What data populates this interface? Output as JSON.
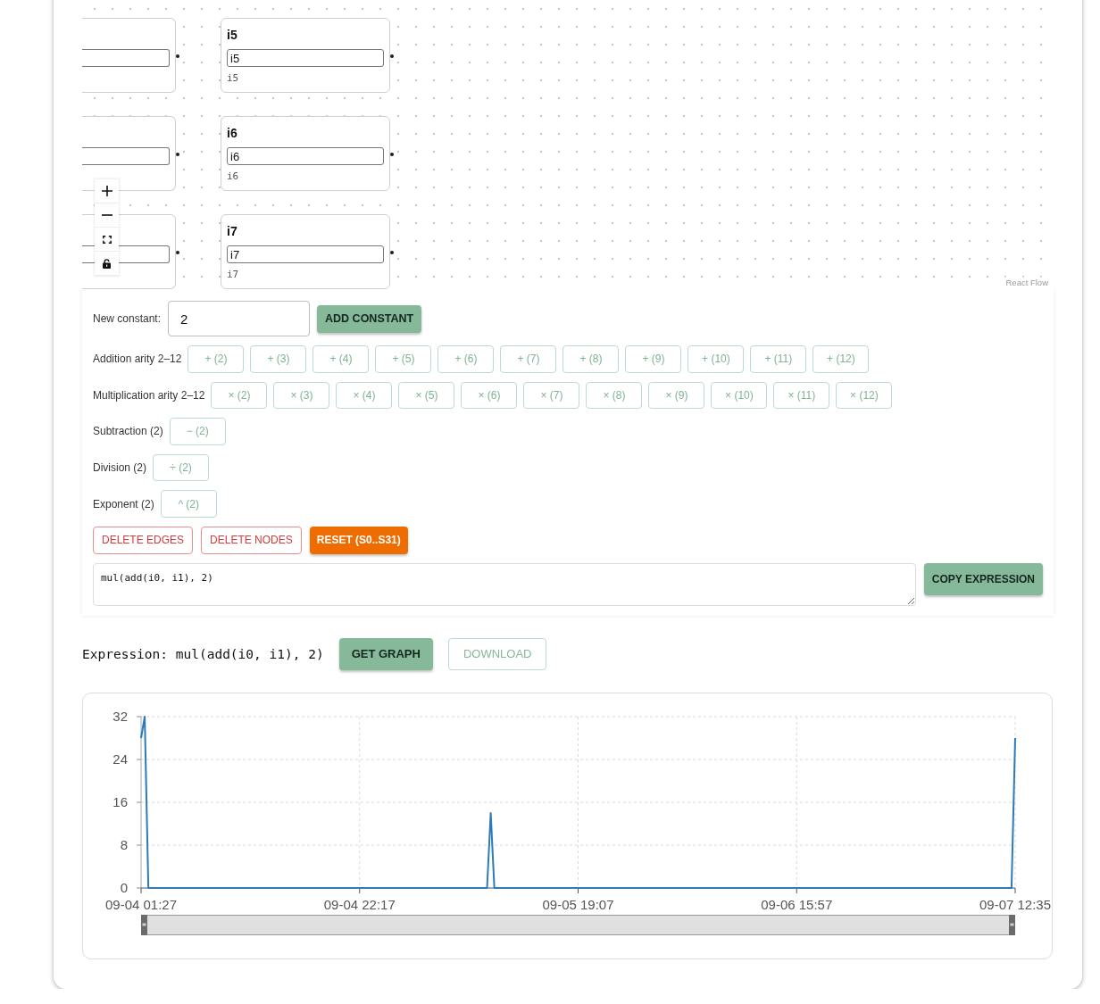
{
  "flow": {
    "nodes": [
      {
        "kind": "clipped"
      },
      {
        "kind": "input",
        "title": "i5",
        "value": "i5",
        "caption": "i5"
      },
      {
        "kind": "clipped"
      },
      {
        "kind": "input",
        "title": "i6",
        "value": "i6",
        "caption": "i6"
      },
      {
        "kind": "clipped"
      },
      {
        "kind": "input",
        "title": "i7",
        "value": "i7",
        "caption": "i7"
      }
    ],
    "locked": false,
    "attribution": "React Flow"
  },
  "controls": {
    "constant": {
      "label": "New constant:",
      "value": "2",
      "button": "ADD CONSTANT"
    },
    "operator_rows": [
      {
        "label": "Addition arity 2–12",
        "buttons": [
          "+ (2)",
          "+ (3)",
          "+ (4)",
          "+ (5)",
          "+ (6)",
          "+ (7)",
          "+ (8)",
          "+ (9)",
          "+ (10)",
          "+ (11)",
          "+ (12)"
        ]
      },
      {
        "label": "Multiplication arity 2–12",
        "buttons": [
          "× (2)",
          "× (3)",
          "× (4)",
          "× (5)",
          "× (6)",
          "× (7)",
          "× (8)",
          "× (9)",
          "× (10)",
          "× (11)",
          "× (12)"
        ]
      },
      {
        "label": "Subtraction (2)",
        "buttons": [
          "− (2)"
        ]
      },
      {
        "label": "Division (2)",
        "buttons": [
          "÷ (2)"
        ]
      },
      {
        "label": "Exponent (2)",
        "buttons": [
          "^ (2)"
        ]
      }
    ],
    "actions": [
      {
        "label": "DELETE EDGES",
        "kind": "danger"
      },
      {
        "label": "DELETE NODES",
        "kind": "danger"
      },
      {
        "label": "RESET (S0..S31)",
        "kind": "warning"
      }
    ],
    "expression_box": {
      "value": "mul(add(i0, i1), 2)",
      "button": "COPY EXPRESSION"
    }
  },
  "expression_bar": {
    "text": "Expression: mul(add(i0, i1), 2)",
    "buttons": [
      {
        "label": "GET GRAPH",
        "kind": "primary"
      },
      {
        "label": "DOWNLOAD",
        "kind": "secondary"
      }
    ]
  },
  "chart": {
    "chart_data": {
      "type": "line",
      "grid": true,
      "categories": [
        "09-04 01:27",
        null,
        null,
        null,
        null,
        null,
        null,
        null,
        null,
        null,
        null,
        null,
        null,
        null,
        null,
        null,
        null,
        null,
        null,
        null,
        null,
        null,
        null,
        null,
        null,
        null,
        null,
        null,
        null,
        null,
        null,
        null,
        null,
        null,
        null,
        null,
        null,
        null,
        null,
        null,
        null,
        null,
        null,
        null,
        null,
        null,
        null,
        null,
        null,
        null,
        null,
        null,
        null,
        null,
        null,
        null,
        null,
        null,
        null,
        null,
        "09-04 22:17",
        null,
        null,
        null,
        null,
        null,
        null,
        null,
        null,
        null,
        null,
        null,
        null,
        null,
        null,
        null,
        null,
        null,
        null,
        null,
        null,
        null,
        null,
        null,
        null,
        null,
        null,
        null,
        null,
        null,
        null,
        null,
        null,
        null,
        null,
        null,
        null,
        null,
        null,
        null,
        null,
        null,
        null,
        null,
        null,
        null,
        null,
        null,
        null,
        null,
        null,
        null,
        null,
        null,
        null,
        null,
        null,
        null,
        null,
        null,
        "09-05 19:07",
        null,
        null,
        null,
        null,
        null,
        null,
        null,
        null,
        null,
        null,
        null,
        null,
        null,
        null,
        null,
        null,
        null,
        null,
        null,
        null,
        null,
        null,
        null,
        null,
        null,
        null,
        null,
        null,
        null,
        null,
        null,
        null,
        null,
        null,
        null,
        null,
        null,
        null,
        null,
        null,
        null,
        null,
        null,
        null,
        null,
        null,
        null,
        null,
        null,
        null,
        null,
        null,
        null,
        null,
        null,
        null,
        null,
        null,
        null,
        "09-06 15:57",
        null,
        null,
        null,
        null,
        null,
        null,
        null,
        null,
        null,
        null,
        null,
        null,
        null,
        null,
        null,
        null,
        null,
        null,
        null,
        null,
        null,
        null,
        null,
        null,
        null,
        null,
        null,
        null,
        null,
        null,
        null,
        null,
        null,
        null,
        null,
        null,
        null,
        null,
        null,
        null,
        null,
        null,
        null,
        null,
        null,
        null,
        null,
        null,
        null,
        null,
        null,
        null,
        null,
        null,
        null,
        null,
        null,
        null,
        null,
        "09-07 12:35"
      ],
      "series": [
        {
          "color": "#2b7bba",
          "values": [
            28,
            32,
            0,
            0,
            0,
            0,
            0,
            0,
            0,
            0,
            0,
            0,
            0,
            0,
            0,
            0,
            0,
            0,
            0,
            0,
            0,
            0,
            0,
            0,
            0,
            0,
            0,
            0,
            0,
            0,
            0,
            0,
            0,
            0,
            0,
            0,
            0,
            0,
            0,
            0,
            0,
            0,
            0,
            0,
            0,
            0,
            0,
            0,
            0,
            0,
            0,
            0,
            0,
            0,
            0,
            0,
            0,
            0,
            0,
            0,
            0,
            0,
            0,
            0,
            0,
            0,
            0,
            0,
            0,
            0,
            0,
            0,
            0,
            0,
            0,
            0,
            0,
            0,
            0,
            0,
            0,
            0,
            0,
            0,
            0,
            0,
            0,
            0,
            0,
            0,
            0,
            0,
            0,
            0,
            0,
            0,
            14,
            0,
            0,
            0,
            0,
            0,
            0,
            0,
            0,
            0,
            0,
            0,
            0,
            0,
            0,
            0,
            0,
            0,
            0,
            0,
            0,
            0,
            0,
            0,
            0,
            0,
            0,
            0,
            0,
            0,
            0,
            0,
            0,
            0,
            0,
            0,
            0,
            0,
            0,
            0,
            0,
            0,
            0,
            0,
            0,
            0,
            0,
            0,
            0,
            0,
            0,
            0,
            0,
            0,
            0,
            0,
            0,
            0,
            0,
            0,
            0,
            0,
            0,
            0,
            0,
            0,
            0,
            0,
            0,
            0,
            0,
            0,
            0,
            0,
            0,
            0,
            0,
            0,
            0,
            0,
            0,
            0,
            0,
            0,
            0,
            0,
            0,
            0,
            0,
            0,
            0,
            0,
            0,
            0,
            0,
            0,
            0,
            0,
            0,
            0,
            0,
            0,
            0,
            0,
            0,
            0,
            0,
            0,
            0,
            0,
            0,
            0,
            0,
            0,
            0,
            0,
            0,
            0,
            0,
            0,
            0,
            0,
            0,
            0,
            0,
            0,
            0,
            0,
            0,
            0,
            0,
            0,
            0,
            0,
            0,
            0,
            0,
            0,
            0,
            0,
            0,
            0,
            0,
            0,
            28
          ]
        }
      ],
      "ylim": [
        0,
        32
      ],
      "yticks": [
        0,
        8,
        16,
        24,
        32
      ]
    },
    "slider": {
      "level": 1
    }
  }
}
